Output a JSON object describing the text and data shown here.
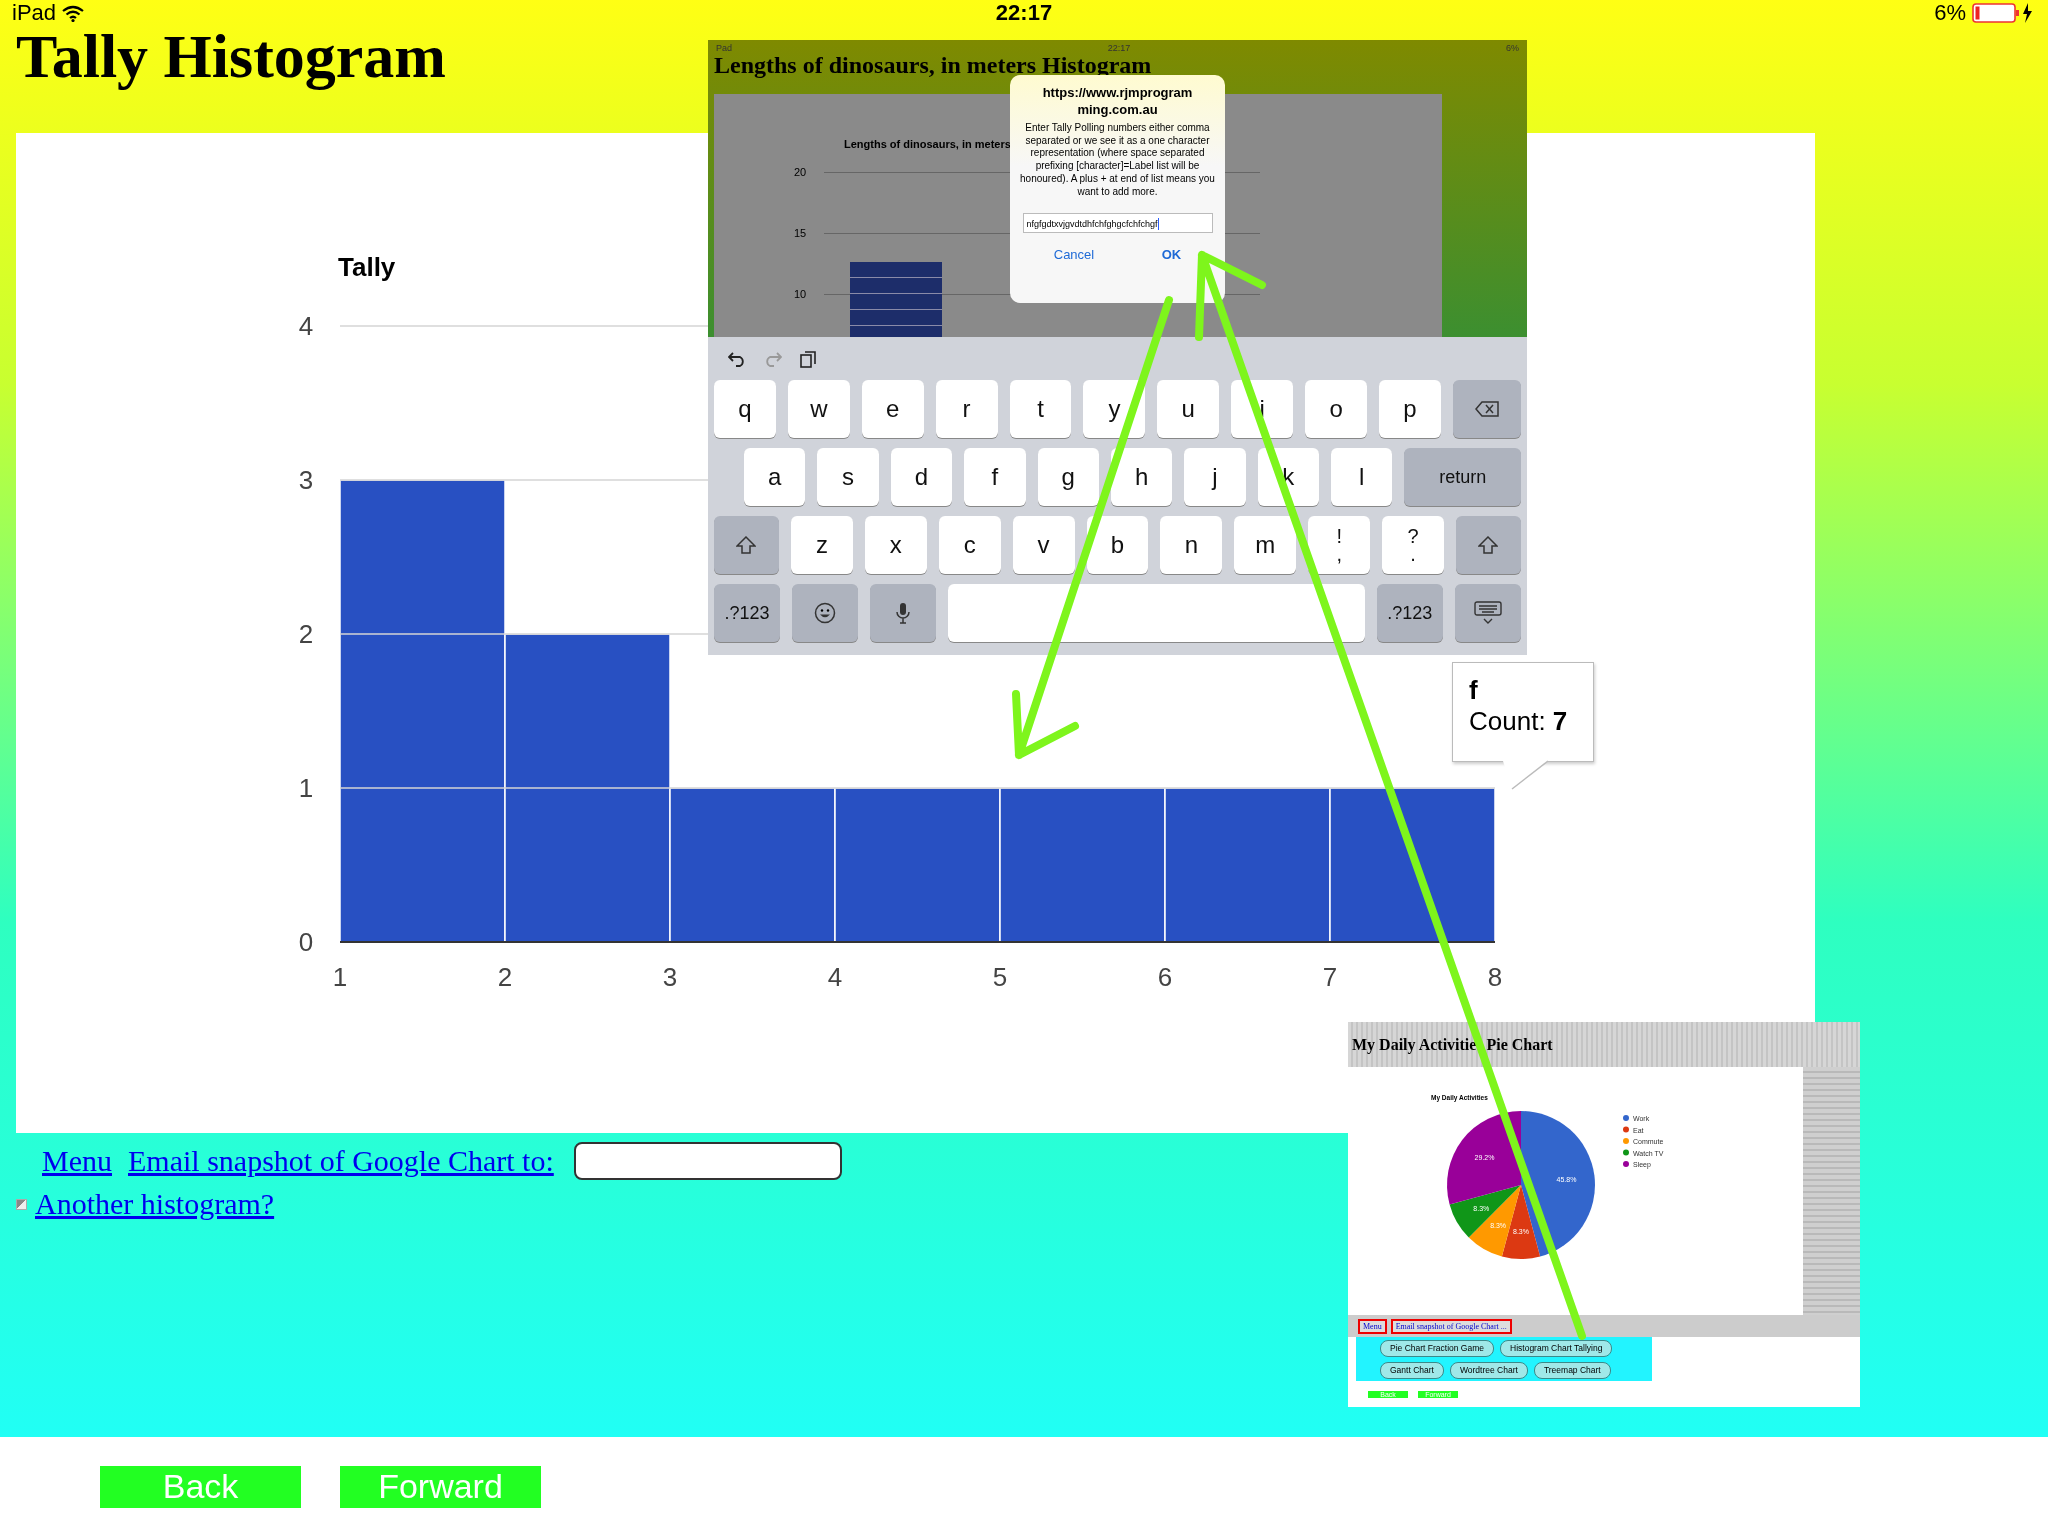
{
  "status_bar": {
    "device": "iPad",
    "time": "22:17",
    "battery": "6%"
  },
  "title": "Tally Histogram",
  "chart": {
    "chart_data": {
      "type": "bar",
      "title": "Tally",
      "x": [
        1.5,
        2.5,
        3.5,
        4.5,
        5.5,
        6.5,
        7.5
      ],
      "values": [
        3,
        2,
        1,
        1,
        1,
        1,
        1
      ],
      "xlim": [
        1,
        8
      ],
      "ylim": [
        0,
        4
      ],
      "xticks": [
        1,
        2,
        3,
        4,
        5,
        6,
        7,
        8
      ],
      "yticks": [
        0,
        1,
        2,
        3,
        4
      ],
      "grid": true
    },
    "tooltip": {
      "label": "f",
      "count": "Count: **7**"
    }
  },
  "links": {
    "menu": "Menu",
    "email": "Email snapshot of Google Chart to:",
    "another": "Another histogram?"
  },
  "nav": {
    "back": "Back",
    "forward": "Forward"
  },
  "inset": {
    "status": {
      "device": "Pad",
      "time": "22:17",
      "battery": "6%"
    },
    "title": "Lengths of dinosaurs, in meters Histogram",
    "chart_title": "Lengths of dinosaurs, in meters",
    "yticks": [
      "20",
      "15",
      "10"
    ],
    "dialog": {
      "origin": "https://www.rjmprogramming.com.au",
      "message": "Enter Tally Polling numbers either comma separated or we see it as a one character representation (where space separated prefixing [character]=Label list will be honoured).  A plus + at end of list means you want to add more.",
      "value": "nfgfgdtxvjgvdtdhfchfghgcfchfchgf",
      "cancel": "Cancel",
      "ok": "OK"
    },
    "keyboard": [
      [
        {
          "kind": "char",
          "label": "q"
        },
        {
          "kind": "char",
          "label": "w"
        },
        {
          "kind": "char",
          "label": "e"
        },
        {
          "kind": "char",
          "label": "r"
        },
        {
          "kind": "char",
          "label": "t"
        },
        {
          "kind": "char",
          "label": "y"
        },
        {
          "kind": "char",
          "label": "u"
        },
        {
          "kind": "char",
          "label": "i"
        },
        {
          "kind": "char",
          "label": "o"
        },
        {
          "kind": "char",
          "label": "p"
        },
        {
          "kind": "backspace"
        }
      ],
      [
        {
          "kind": "char",
          "label": "a"
        },
        {
          "kind": "char",
          "label": "s"
        },
        {
          "kind": "char",
          "label": "d"
        },
        {
          "kind": "char",
          "label": "f"
        },
        {
          "kind": "char",
          "label": "g"
        },
        {
          "kind": "char",
          "label": "h"
        },
        {
          "kind": "char",
          "label": "j"
        },
        {
          "kind": "char",
          "label": "k"
        },
        {
          "kind": "char",
          "label": "l"
        },
        {
          "kind": "action",
          "label": "return"
        }
      ],
      [
        {
          "kind": "shift"
        },
        {
          "kind": "char",
          "label": "z"
        },
        {
          "kind": "char",
          "label": "x"
        },
        {
          "kind": "char",
          "label": "c"
        },
        {
          "kind": "char",
          "label": "v"
        },
        {
          "kind": "char",
          "label": "b"
        },
        {
          "kind": "char",
          "label": "n"
        },
        {
          "kind": "char",
          "label": "m"
        },
        {
          "kind": "dual",
          "top": "!",
          "bottom": ","
        },
        {
          "kind": "dual",
          "top": "?",
          "bottom": "."
        },
        {
          "kind": "shift"
        }
      ],
      [
        {
          "kind": "action",
          "label": ".?123"
        },
        {
          "kind": "emoji"
        },
        {
          "kind": "mic"
        },
        {
          "kind": "space"
        },
        {
          "kind": "action",
          "label": ".?123"
        },
        {
          "kind": "hide"
        }
      ]
    ]
  },
  "thumbnail": {
    "title": [
      "My Daily Activitie",
      "Pie Chart"
    ],
    "chart_data": {
      "type": "pie",
      "title": "My Daily Activities",
      "categories": [
        "Work",
        "Eat",
        "Commute",
        "Watch TV",
        "Sleep"
      ],
      "values": [
        45.8,
        8.3,
        8.3,
        8.3,
        29.2
      ],
      "legend": true,
      "value_labels": [
        "45.8%",
        "8.3%",
        "8.3%",
        "8.3%",
        "29.2%"
      ],
      "colors": [
        "#3366cc",
        "#dc3912",
        "#ff9900",
        "#109618",
        "#990099"
      ]
    },
    "menu": "Menu",
    "email": "Email snapshot of Google Chart ...",
    "pills": [
      "Pie Chart Fraction Game",
      "Histogram Chart Tallying",
      "Gantt Chart",
      "Wordtree Chart",
      "Treemap Chart"
    ],
    "back": "Back",
    "forward": "Forward"
  }
}
